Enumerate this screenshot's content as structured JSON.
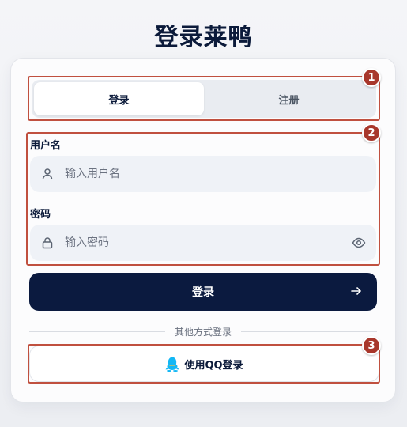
{
  "page": {
    "title": "登录莱鸭"
  },
  "tabs": [
    {
      "label": "登录",
      "active": true
    },
    {
      "label": "注册",
      "active": false
    }
  ],
  "form": {
    "username": {
      "label": "用户名",
      "placeholder": "输入用户名",
      "icon": "user-icon"
    },
    "password": {
      "label": "密码",
      "placeholder": "输入密码",
      "icon": "lock-icon",
      "toggle_icon": "eye-icon"
    }
  },
  "submit": {
    "label": "登录",
    "icon": "arrow-right-icon"
  },
  "divider": {
    "text": "其他方式登录"
  },
  "qq": {
    "label": "使用QQ登录",
    "icon": "qq-penguin-icon",
    "icon_color": "#12b7f5"
  },
  "annotations": [
    {
      "number": "1"
    },
    {
      "number": "2"
    },
    {
      "number": "3"
    }
  ],
  "colors": {
    "primary": "#0b1a3f",
    "annotation": "#c0503f",
    "badge": "#a8372b"
  }
}
